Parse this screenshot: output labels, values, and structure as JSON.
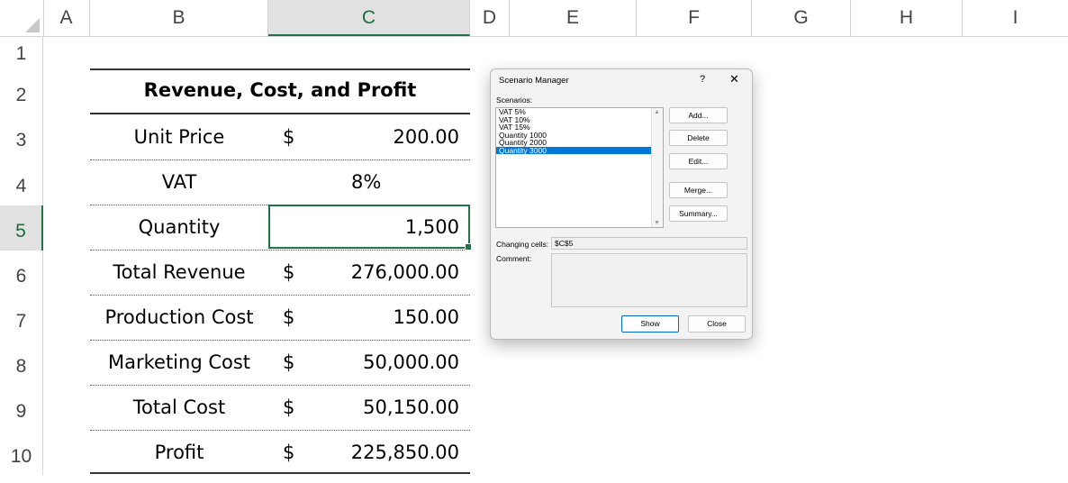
{
  "columns": [
    "A",
    "B",
    "C",
    "D",
    "E",
    "F",
    "G",
    "H",
    "I"
  ],
  "rows": [
    "1",
    "2",
    "3",
    "4",
    "5",
    "6",
    "7",
    "8",
    "9",
    "10"
  ],
  "table": {
    "title": "Revenue, Cost, and Profit",
    "currency_symbol": "$",
    "rows": [
      {
        "label": "Unit Price",
        "currency": "$",
        "value": "200.00"
      },
      {
        "label": "VAT",
        "currency": "",
        "value": "8%"
      },
      {
        "label": "Quantity",
        "currency": "",
        "value": "1,500"
      },
      {
        "label": "Total Revenue",
        "currency": "$",
        "value": "276,000.00"
      },
      {
        "label": "Production Cost",
        "currency": "$",
        "value": "150.00"
      },
      {
        "label": "Marketing Cost",
        "currency": "$",
        "value": "50,000.00"
      },
      {
        "label": "Total Cost",
        "currency": "$",
        "value": "50,150.00"
      },
      {
        "label": "Profit",
        "currency": "$",
        "value": "225,850.00"
      }
    ]
  },
  "selection": {
    "column": "C",
    "row": "5"
  },
  "dialog": {
    "title": "Scenario Manager",
    "help": "?",
    "close": "✕",
    "scenarios_label": "Scenarios:",
    "scenarios": [
      "VAT 5%",
      "VAT 10%",
      "VAT 15%",
      "Quantity 1000",
      "Quantity 2000",
      "Quantity 3000"
    ],
    "selected_scenario": "Quantity 3000",
    "buttons": {
      "add": "Add...",
      "delete": "Delete",
      "edit": "Edit...",
      "merge": "Merge...",
      "summary": "Summary..."
    },
    "changing_cells_label": "Changing cells:",
    "changing_cells_value": "$C$5",
    "comment_label": "Comment:",
    "comment_value": "",
    "show": "Show",
    "close_button": "Close"
  },
  "colors": {
    "accent": "#217346",
    "selection": "#0078d7"
  }
}
